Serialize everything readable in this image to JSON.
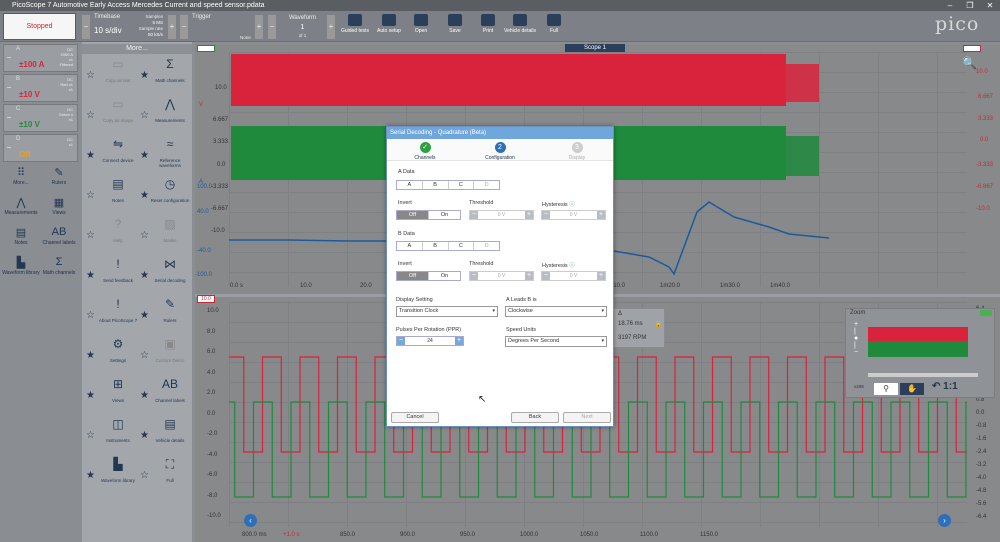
{
  "window": {
    "title": "PicoScope 7 Automotive Early Access Mercedes Current and speed sensor.pdata"
  },
  "toolbar": {
    "status": "Stopped",
    "timebase_label": "Timebase",
    "timebase_value": "10 s/div",
    "samples_label": "Samples",
    "samples_value": "5 MS",
    "sample_rate_label": "Sample rate",
    "sample_rate_value": "50 kS/s",
    "trigger_label": "Trigger",
    "trigger_mode": "None",
    "waveform_label": "Waveform",
    "waveform_index": "1",
    "waveform_of": "of 1",
    "buttons": [
      "Guided tests",
      "Auto setup",
      "Open",
      "Save",
      "Print",
      "Vehicle details",
      "Full"
    ],
    "brand": "pico"
  },
  "channels": [
    {
      "name": "A",
      "coupling": "DC",
      "probe": "2000 A",
      "detail": "x1",
      "extra": "Filtered",
      "range": "±100 A",
      "color": "#d9233d"
    },
    {
      "name": "B",
      "coupling": "DC",
      "probe": "Red x1",
      "detail": "x1",
      "range": "±10 V",
      "color": "#d9233d"
    },
    {
      "name": "C",
      "coupling": "DC",
      "probe": "Green x",
      "detail": "x1",
      "range": "±10 V",
      "color": "#1f8a3c"
    },
    {
      "name": "D",
      "coupling": "DC",
      "probe": "",
      "detail": "x1",
      "range": "Off",
      "color": "#e0a12a"
    }
  ],
  "left_tools": [
    "More...",
    "Rulers",
    "Measurements",
    "Views",
    "Notes",
    "Channel labels",
    "Waveform library",
    "Math channels"
  ],
  "more_panel": {
    "title": "More...",
    "items": [
      {
        "label": "Copy as text",
        "dim": true
      },
      {
        "label": "Math channels",
        "dim": false
      },
      {
        "label": "Copy as image",
        "dim": true
      },
      {
        "label": "Measurements",
        "dim": false
      },
      {
        "label": "Connect device",
        "dim": false
      },
      {
        "label": "Reference waveforms",
        "dim": false
      },
      {
        "label": "Notes",
        "dim": false
      },
      {
        "label": "Reset configuration",
        "dim": false
      },
      {
        "label": "Help",
        "dim": true
      },
      {
        "label": "Masks",
        "dim": true
      },
      {
        "label": "Send feedback",
        "dim": false
      },
      {
        "label": "Serial decoding",
        "dim": false
      },
      {
        "label": "About PicoScope 7",
        "dim": false
      },
      {
        "label": "Rulers",
        "dim": false
      },
      {
        "label": "Settings",
        "dim": false
      },
      {
        "label": "Custom Demo",
        "dim": true
      },
      {
        "label": "Views",
        "dim": false
      },
      {
        "label": "Channel labels",
        "dim": false
      },
      {
        "label": "Instruments",
        "dim": false
      },
      {
        "label": "Vehicle details",
        "dim": false
      },
      {
        "label": "Waveform library",
        "dim": false
      },
      {
        "label": "Full",
        "dim": false
      }
    ]
  },
  "scope": {
    "tab_title": "Scope 1",
    "top_axis_left": [
      "10.0",
      "6.667",
      "3.333",
      "0.0",
      "-3.333",
      "-6.667",
      "-10.0"
    ],
    "top_axis_left_units": [
      "V",
      "A"
    ],
    "top_axis_left2": [
      "100.0",
      "80.0",
      "40.0",
      "20.0",
      "-40.0",
      "-80.0",
      "-100.0"
    ],
    "top_axis_right": [
      "10.0",
      "6.667",
      "3.333",
      "0.0",
      "-3.333",
      "-6.667",
      "-10.0"
    ],
    "top_time_labels": [
      "0.0 s",
      "10.0",
      "20.0",
      "30.0",
      "40.0",
      "1m0.0",
      "1m10.0",
      "1m20.0",
      "1m30.0",
      "1m40.0"
    ],
    "bottom_axis_left": [
      "10.0",
      "8.0",
      "6.0",
      "4.0",
      "2.0",
      "0.0",
      "-2.0",
      "-4.0",
      "-6.0",
      "-8.0",
      "-10.0"
    ],
    "bottom_axis_right": [
      "6.4",
      "5.6",
      "4.8",
      "4.0",
      "3.2",
      "2.4",
      "1.6",
      "0.8",
      "0.0",
      "-0.8",
      "-1.6",
      "-2.4",
      "-3.2",
      "-4.0",
      "-4.8",
      "-5.6",
      "-6.4"
    ],
    "bottom_time_labels": [
      "800.0 ms",
      "+1.0 s",
      "850.0",
      "900.0",
      "950.0",
      "1000.0",
      "1050.0",
      "1100.0",
      "1150.0"
    ],
    "top_left_marker": "10.0",
    "measure": {
      "header": "Δ",
      "value1": "18.76 ms",
      "value2": "3197 RPM"
    },
    "zoom": {
      "title": "Zoom",
      "ratio": "1:1",
      "label_y": "x208"
    }
  },
  "dialog": {
    "title": "Serial Decoding - Quadrature (Beta)",
    "steps": [
      {
        "label": "Channels",
        "state": "done",
        "num": "✓"
      },
      {
        "label": "Configuration",
        "state": "active",
        "num": "2"
      },
      {
        "label": "Display",
        "state": "pending",
        "num": "3"
      }
    ],
    "a_data_label": "A Data",
    "b_data_label": "B Data",
    "channel_opts": [
      "A",
      "B",
      "C",
      "D"
    ],
    "invert_label": "Invert",
    "invert_opts": [
      "Off",
      "On"
    ],
    "threshold_label": "Threshold",
    "threshold_value": "0 V",
    "hysteresis_label": "Hysteresis",
    "hysteresis_value": "0 V",
    "display_setting_label": "Display Setting",
    "display_setting_value": "Transition Clock",
    "a_leads_label": "A Leads B is",
    "a_leads_value": "Clockwise",
    "ppr_label": "Pulses Per Rotation (PPR)",
    "ppr_value": "24",
    "speed_units_label": "Speed Units",
    "speed_units_value": "Degrees Per Second",
    "cancel": "Cancel",
    "back": "Back",
    "next": "Next"
  }
}
